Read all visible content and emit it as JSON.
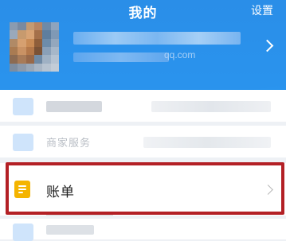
{
  "header": {
    "title": "我的",
    "settings_label": "设置",
    "brand_color": "#2a8ee8"
  },
  "profile": {
    "avatar_icon": "avatar-pixelated",
    "email_visible": "qq.com",
    "chevron_icon": "chevron-right-icon"
  },
  "list": {
    "blurred_item_label": "商家服务",
    "bill_item": {
      "label": "账单",
      "icon": "bill-document-icon",
      "icon_color": "#f4b400",
      "chevron_icon": "chevron-right-icon"
    }
  },
  "annotation": {
    "highlight_color": "#b32025"
  }
}
